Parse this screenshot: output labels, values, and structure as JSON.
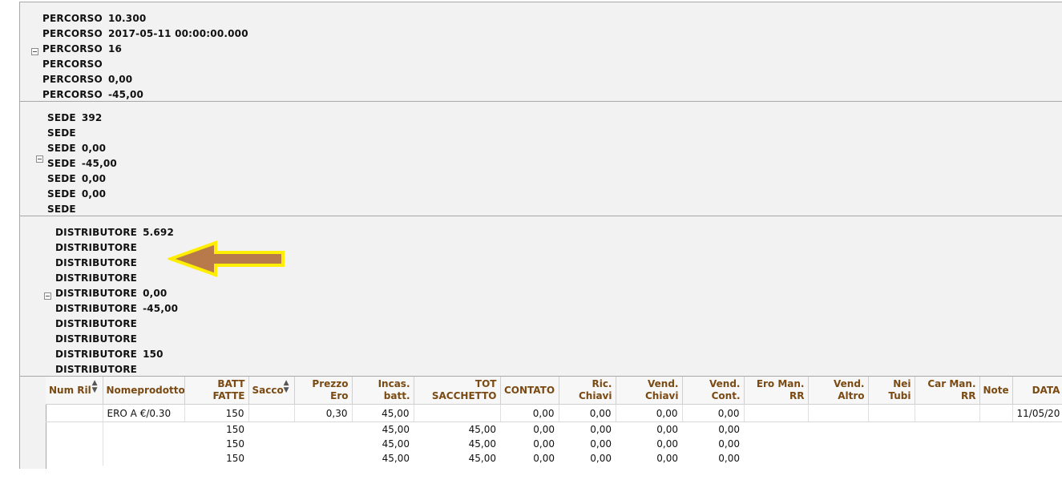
{
  "groups": [
    {
      "lines": [
        {
          "label": "PERCORSO",
          "value": "10.300"
        },
        {
          "label": "PERCORSO",
          "value": "2017-05-11 00:00:00.000"
        },
        {
          "label": "PERCORSO",
          "value": "16"
        },
        {
          "label": "PERCORSO",
          "value": ""
        },
        {
          "label": "PERCORSO",
          "value": "0,00"
        },
        {
          "label": "PERCORSO",
          "value": "-45,00"
        }
      ]
    },
    {
      "lines": [
        {
          "label": "SEDE",
          "value": "392"
        },
        {
          "label": "SEDE",
          "value": ""
        },
        {
          "label": "SEDE",
          "value": "0,00"
        },
        {
          "label": "SEDE",
          "value": "-45,00"
        },
        {
          "label": "SEDE",
          "value": "0,00"
        },
        {
          "label": "SEDE",
          "value": "0,00"
        },
        {
          "label": "SEDE",
          "value": ""
        }
      ]
    },
    {
      "lines": [
        {
          "label": "DISTRIBUTORE",
          "value": "5.692"
        },
        {
          "label": "DISTRIBUTORE",
          "value": ""
        },
        {
          "label": "DISTRIBUTORE",
          "value": ""
        },
        {
          "label": "DISTRIBUTORE",
          "value": ""
        },
        {
          "label": "DISTRIBUTORE",
          "value": "0,00"
        },
        {
          "label": "DISTRIBUTORE",
          "value": "-45,00"
        },
        {
          "label": "DISTRIBUTORE",
          "value": ""
        },
        {
          "label": "DISTRIBUTORE",
          "value": ""
        },
        {
          "label": "DISTRIBUTORE",
          "value": "150"
        },
        {
          "label": "DISTRIBUTORE",
          "value": ""
        }
      ]
    }
  ],
  "annotation": {
    "arrow_fill": "#b87a4b",
    "arrow_outline": "#ffee00"
  },
  "table": {
    "columns": [
      {
        "label": "Num Ril",
        "align": "l",
        "sortable": true
      },
      {
        "label": "Nomeprodotto",
        "align": "l",
        "sortable": false
      },
      {
        "label": "BATT FATTE",
        "align": "r",
        "sortable": false
      },
      {
        "label": "Sacco",
        "align": "l",
        "sortable": true
      },
      {
        "label": "Prezzo Ero",
        "align": "r",
        "sortable": false
      },
      {
        "label": "Incas. batt.",
        "align": "r",
        "sortable": false
      },
      {
        "label": "TOT SACCHETTO",
        "align": "r",
        "sortable": false
      },
      {
        "label": "CONTATO",
        "align": "c",
        "sortable": false
      },
      {
        "label": "Ric. Chiavi",
        "align": "r",
        "sortable": false
      },
      {
        "label": "Vend. Chiavi",
        "align": "r",
        "sortable": false
      },
      {
        "label": "Vend. Cont.",
        "align": "r",
        "sortable": false
      },
      {
        "label": "Ero Man. RR",
        "align": "r",
        "sortable": false
      },
      {
        "label": "Vend. Altro",
        "align": "r",
        "sortable": false
      },
      {
        "label": "Nei Tubi",
        "align": "r",
        "sortable": false
      },
      {
        "label": "Car Man. RR",
        "align": "r",
        "sortable": false
      },
      {
        "label": "Note",
        "align": "c",
        "sortable": false
      },
      {
        "label": "DATA",
        "align": "c",
        "sortable": false
      }
    ],
    "rows": [
      [
        "",
        "ERO A €/0.30",
        "150",
        "",
        "0,30",
        "45,00",
        "",
        "0,00",
        "0,00",
        "0,00",
        "0,00",
        "",
        "",
        "",
        "",
        "",
        "11/05/20"
      ],
      [
        "",
        "",
        "150",
        "",
        "",
        "45,00",
        "45,00",
        "0,00",
        "0,00",
        "0,00",
        "0,00",
        "",
        "",
        "",
        "",
        "",
        ""
      ],
      [
        "",
        "",
        "150",
        "",
        "",
        "45,00",
        "45,00",
        "0,00",
        "0,00",
        "0,00",
        "0,00",
        "",
        "",
        "",
        "",
        "",
        ""
      ],
      [
        "",
        "",
        "150",
        "",
        "",
        "45,00",
        "45,00",
        "0,00",
        "0,00",
        "0,00",
        "0,00",
        "",
        "",
        "",
        "",
        "",
        ""
      ]
    ]
  }
}
